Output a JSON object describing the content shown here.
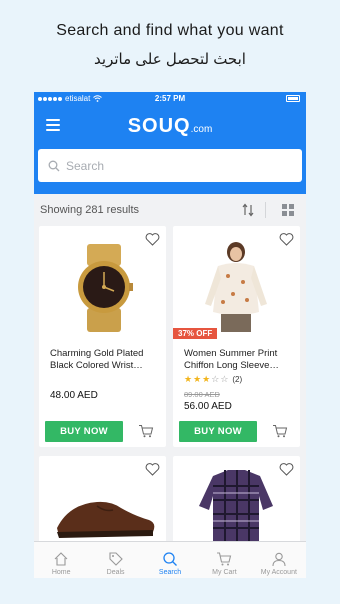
{
  "promo": {
    "english": "Search and find what you want",
    "arabic": "ابحث لتحصل على ماتريد"
  },
  "status_bar": {
    "carrier": "etisalat",
    "time": "2:57 PM"
  },
  "header": {
    "logo": "SOUQ",
    "logo_domain": ".com"
  },
  "search": {
    "placeholder": "Search"
  },
  "results": {
    "text": "Showing 281 results"
  },
  "products": [
    {
      "title": "Charming Gold Plated Black Colored Wrist…",
      "price": "48.00 AED",
      "buy_label": "BUY NOW"
    },
    {
      "title": "Women Summer Print Chiffon Long Sleeve…",
      "discount": "37% OFF",
      "rating_count": "(2)",
      "rating_stars": 3,
      "old_price": "89.00 AED",
      "price": "56.00 AED",
      "buy_label": "BUY NOW"
    }
  ],
  "tabs": [
    {
      "label": "Home",
      "icon": "home-icon"
    },
    {
      "label": "Deals",
      "icon": "tag-icon"
    },
    {
      "label": "Search",
      "icon": "search-icon"
    },
    {
      "label": "My Cart",
      "icon": "cart-icon"
    },
    {
      "label": "My Account",
      "icon": "user-icon"
    }
  ],
  "colors": {
    "brand_blue": "#1e82f2",
    "buy_green": "#33b865",
    "discount_red": "#e6553f",
    "star_yellow": "#f2b51d"
  }
}
